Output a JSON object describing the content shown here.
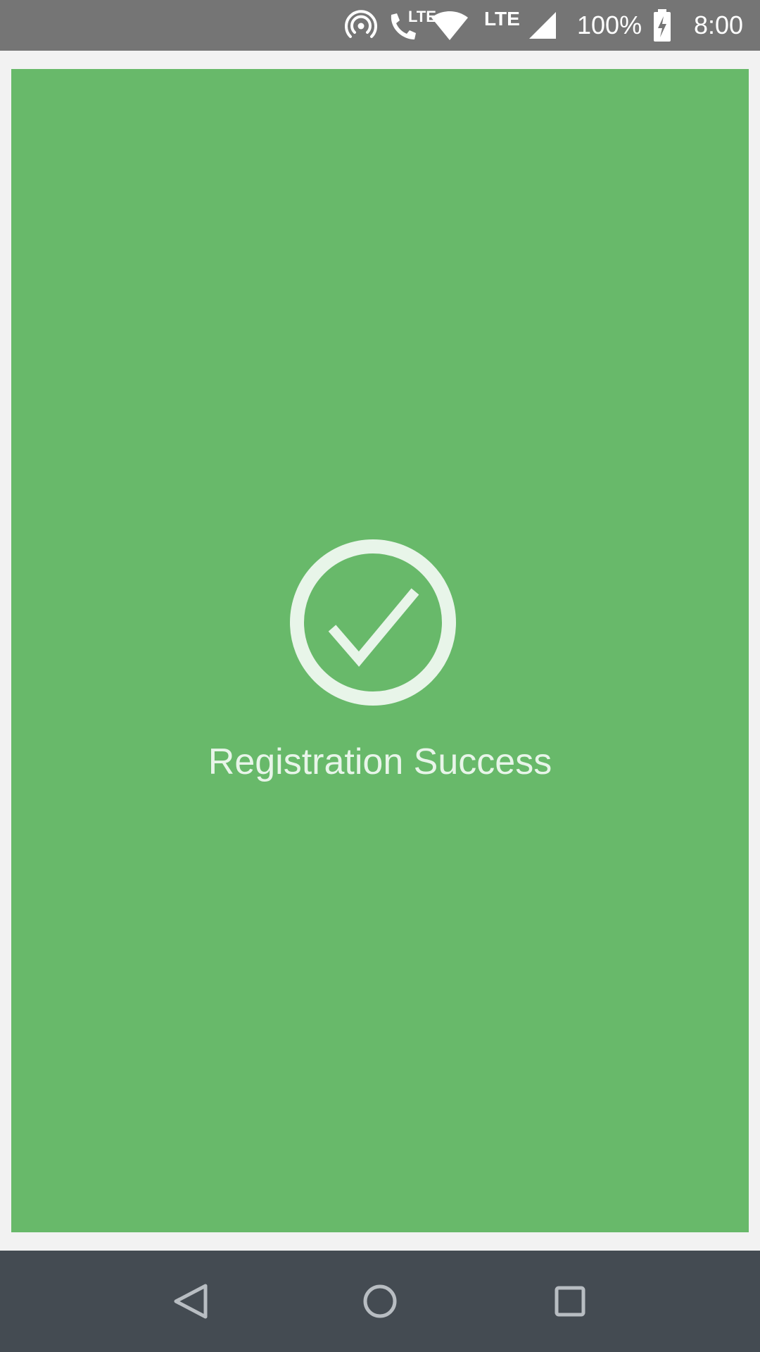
{
  "status_bar": {
    "time": "8:00",
    "battery": "100%",
    "call_lte": "LTE",
    "network_lte": "LTE",
    "icons": [
      "hotspot-icon",
      "volte-call-icon",
      "wifi-icon",
      "signal-icon",
      "battery-charging-icon"
    ]
  },
  "screen": {
    "message": "Registration Success",
    "icon": "check-circle-icon",
    "background_color": "#68b96a",
    "foreground_color": "#e8f5e9"
  },
  "nav_bar": {
    "buttons": [
      "back",
      "home",
      "recents"
    ],
    "background_color": "#444b52"
  }
}
